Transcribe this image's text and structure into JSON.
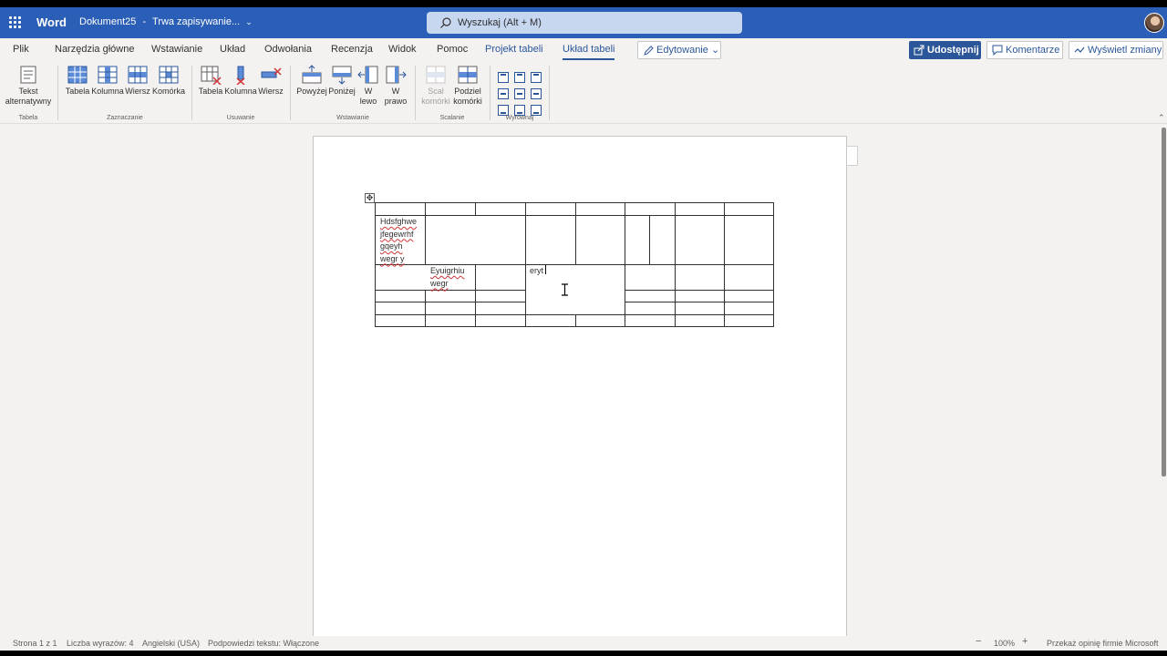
{
  "titlebar": {
    "app_name": "Word",
    "doc_name": "Dokument25",
    "separator": "-",
    "save_status": "Trwa zapisywanie...",
    "search_placeholder": "Wyszukaj (Alt + M)"
  },
  "tabs": [
    "Plik",
    "Narzędzia główne",
    "Wstawianie",
    "Układ",
    "Odwołania",
    "Recenzja",
    "Widok",
    "Pomoc",
    "Projekt tabeli",
    "Układ tabeli"
  ],
  "active_tab": "Układ tabeli",
  "actions": {
    "editing": "Edytowanie",
    "share": "Udostępnij",
    "comments": "Komentarze",
    "changes": "Wyświetl zmiany"
  },
  "ribbon": {
    "groups": {
      "tabela": "Tabela",
      "zaznaczanie": "Zaznaczanie",
      "usuwanie": "Usuwanie",
      "wstawianie": "Wstawianie",
      "scalanie": "Scalanie",
      "wyrownaj": "Wyrównaj"
    },
    "buttons": {
      "alt_text_1": "Tekst",
      "alt_text_2": "alternatywny",
      "select_table": "Tabela",
      "select_column": "Kolumna",
      "select_row": "Wiersz",
      "select_cell": "Komórka",
      "delete_table": "Tabela",
      "delete_column": "Kolumna",
      "delete_row": "Wiersz",
      "insert_above": "Powyżej",
      "insert_below": "Poniżej",
      "insert_left_1": "W",
      "insert_left_2": "lewo",
      "insert_right_1": "W",
      "insert_right_2": "prawo",
      "merge_1": "Scal",
      "merge_2": "komórki",
      "split_1": "Podziel",
      "split_2": "komórki"
    }
  },
  "document": {
    "cell_1": [
      "Hdsfghwe",
      "jfegewrhf",
      "gqeyh",
      "wegr y"
    ],
    "cell_2": [
      "Eyuigrhiu",
      "wegr"
    ],
    "cell_3": "eryt"
  },
  "statusbar": {
    "page": "Strona 1 z 1",
    "words": "Liczba wyrazów: 4",
    "language": "Angielski (USA)",
    "predictions": "Podpowiedzi tekstu: Włączone",
    "zoom_minus": "−",
    "zoom": "100%",
    "zoom_plus": "+",
    "feedback": "Przekaż opinię firmie Microsoft"
  }
}
